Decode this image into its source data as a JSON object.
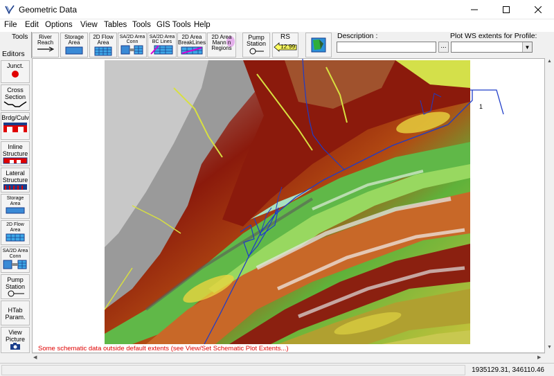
{
  "window": {
    "title": "Geometric Data"
  },
  "menu": [
    "File",
    "Edit",
    "Options",
    "View",
    "Tables",
    "Tools",
    "GIS Tools",
    "Help"
  ],
  "toolbar": {
    "tools_label": "Tools",
    "buttons": {
      "river_reach": "River\nReach",
      "storage_area": "Storage\nArea",
      "flow_2d_area": "2D Flow\nArea",
      "sa2d_conn": "SA/2D Area\nConn",
      "sa2d_bc": "SA/2D Area\nBC Lines",
      "breaklines": "2D Area\nBreakLines",
      "manning": "2D Area\nMann n\nRegions",
      "pump_station": "Pump\nStation",
      "rs": "RS",
      "rs_value": "12.99"
    },
    "description_label": "Description :",
    "description_value": "",
    "more_button": "...",
    "plot_ws_label": "Plot WS extents for Profile:",
    "plot_ws_value": ""
  },
  "editors": {
    "label": "Editors",
    "buttons": {
      "junct": "Junct.",
      "cross_section": "Cross\nSection",
      "brdg_culv": "Brdg/Culv",
      "inline_structure": "Inline\nStructure",
      "lateral_structure": "Lateral\nStructure",
      "storage_area": "Storage\nArea",
      "flow_2d_area": "2D Flow\nArea",
      "sa2d_conn": "SA/2D Area\nConn",
      "pump_station": "Pump\nStation",
      "htab": "HTab\nParam.",
      "view_picture": "View\nPicture"
    }
  },
  "canvas": {
    "reach_label": "1",
    "warning": "Some schematic data outside default extents (see View/Set Schematic Plot Extents...)"
  },
  "status": {
    "coordinates": "1935129.31, 346110.46"
  },
  "colors": {
    "warning": "#e00000",
    "river_line": "#1e3cc8"
  }
}
